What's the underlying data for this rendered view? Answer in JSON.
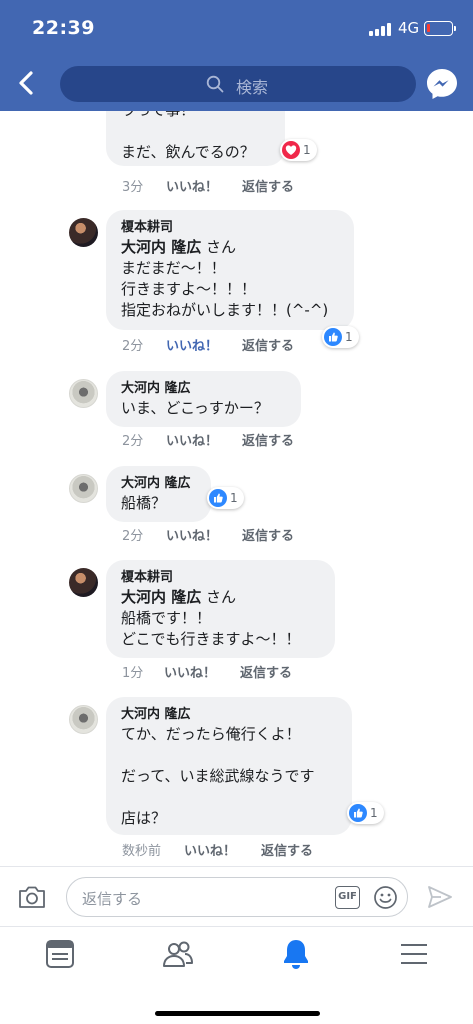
{
  "status_bar": {
    "time": "22:39",
    "network": "4G"
  },
  "header": {
    "search_placeholder": "検索"
  },
  "comments": [
    {
      "author": "",
      "lines": [
        "ラって事？",
        "",
        "まだ、飲んでるの？"
      ],
      "time": "3分",
      "like_label": "いいね！",
      "like_active": false,
      "reply_label": "返信する",
      "reaction": {
        "type": "love",
        "count": "1"
      }
    },
    {
      "author": "榎本耕司",
      "mention": "大河内 隆広",
      "mention_suffix": " さん",
      "lines": [
        "まだまだ〜！！",
        "行きますよ〜！！！",
        "指定おねがいします！！(^-^)"
      ],
      "time": "2分",
      "like_label": "いいね！",
      "like_active": true,
      "reply_label": "返信する",
      "reaction": {
        "type": "like",
        "count": "1"
      }
    },
    {
      "author": "大河内 隆広",
      "lines": [
        "いま、どこっすかー？"
      ],
      "time": "2分",
      "like_label": "いいね！",
      "like_active": false,
      "reply_label": "返信する"
    },
    {
      "author": "大河内 隆広",
      "lines": [
        "船橋？"
      ],
      "time": "2分",
      "like_label": "いいね！",
      "like_active": false,
      "reply_label": "返信する",
      "reaction": {
        "type": "like",
        "count": "1"
      }
    },
    {
      "author": "榎本耕司",
      "mention": "大河内 隆広",
      "mention_suffix": " さん",
      "lines": [
        "船橋です！！",
        "どこでも行きますよ〜！！"
      ],
      "time": "1分",
      "like_label": "いいね！",
      "like_active": false,
      "reply_label": "返信する"
    },
    {
      "author": "大河内 隆広",
      "lines": [
        "てか、だったら俺行くよ！",
        "",
        "だって、いま総武線なうです",
        "",
        "店は？"
      ],
      "time": "数秒前",
      "like_label": "いいね！",
      "like_active": false,
      "reply_label": "返信する",
      "reaction": {
        "type": "like",
        "count": "1"
      }
    }
  ],
  "composer": {
    "placeholder": "返信する",
    "gif_label": "GIF"
  },
  "tabs": [
    {
      "name": "news-feed",
      "icon": "news-feed-icon",
      "active": false
    },
    {
      "name": "friends",
      "icon": "friends-icon",
      "active": false
    },
    {
      "name": "notifications",
      "icon": "bell-icon",
      "active": true
    },
    {
      "name": "menu",
      "icon": "hamburger-icon",
      "active": false
    }
  ],
  "colors": {
    "brand": "#4267b2",
    "active_link": "#4267b2",
    "like_reaction": "#2d88ff",
    "love_reaction": "#f0284a",
    "battery_low": "#ff3b30"
  }
}
